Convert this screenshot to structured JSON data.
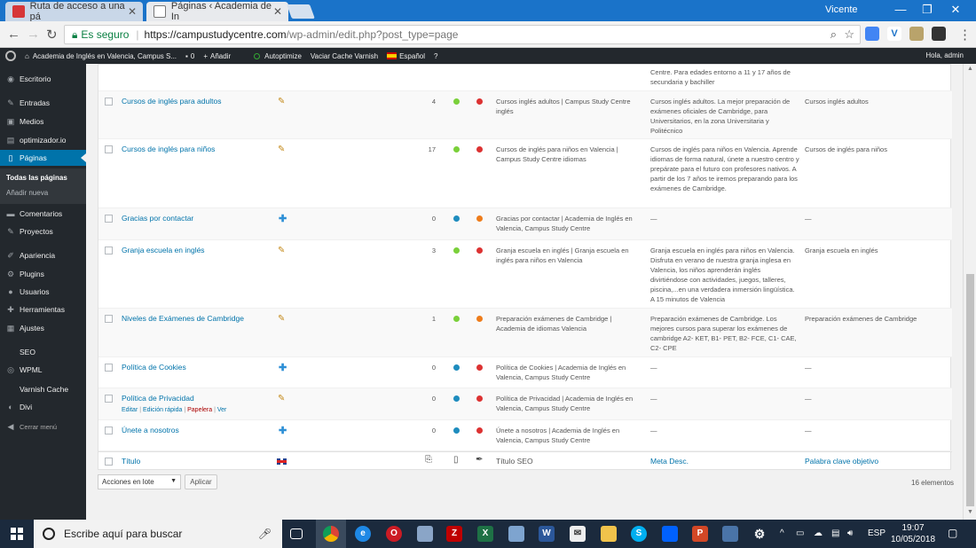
{
  "browser": {
    "tabs": [
      {
        "label": "Ruta de acceso a una pá"
      },
      {
        "label": "Páginas ‹ Academia de In"
      }
    ],
    "user": "Vicente",
    "omnibox": {
      "secure_label": "Es seguro",
      "url_host": "https://campustudycentre.com",
      "url_path": "/wp-admin/edit.php?post_type=page"
    }
  },
  "adminbar": {
    "site": "Academia de Inglés en Valencia, Campus S...",
    "comments": "0",
    "add_new": "Añadir",
    "autoptimize": "Autoptimize",
    "varnish": "Vaciar Cache Varnish",
    "language": "Español",
    "greeting": "Hola, admin"
  },
  "sidebar": {
    "items": [
      {
        "label": "Escritorio",
        "icon": "dashboard-icon"
      },
      {
        "label": "Entradas",
        "icon": "pin-icon"
      },
      {
        "label": "Medios",
        "icon": "media-icon"
      },
      {
        "label": "optimizador.io",
        "icon": "optimizer-icon"
      },
      {
        "label": "Páginas",
        "icon": "pages-icon"
      },
      {
        "label": "Comentarios",
        "icon": "comments-icon"
      },
      {
        "label": "Proyectos",
        "icon": "projects-icon"
      },
      {
        "label": "Apariencia",
        "icon": "appearance-icon"
      },
      {
        "label": "Plugins",
        "icon": "plugins-icon"
      },
      {
        "label": "Usuarios",
        "icon": "users-icon"
      },
      {
        "label": "Herramientas",
        "icon": "tools-icon"
      },
      {
        "label": "Ajustes",
        "icon": "settings-icon"
      },
      {
        "label": "SEO",
        "icon": ""
      },
      {
        "label": "WPML",
        "icon": "wpml-icon"
      },
      {
        "label": "Varnish Cache",
        "icon": ""
      },
      {
        "label": "Divi",
        "icon": "divi-icon"
      },
      {
        "label": "Cerrar menú",
        "icon": "collapse-icon"
      }
    ],
    "submenu": {
      "all_pages": "Todas las páginas",
      "add_new": "Añadir nueva"
    }
  },
  "table": {
    "top_partial": {
      "meta": "Centre. Para edades entorno a 11 y 17 años de secundaria y bachiller"
    },
    "rows": [
      {
        "title": "Cursos de inglés para adultos",
        "count": "4",
        "seo_title": "Cursos inglés adultos | Campus Study Centre inglés",
        "meta": "Cursos inglés adultos. La mejor preparación de exámenes oficiales de Cambridge, para Universitarios, en la zona Universitaria y Politécnico",
        "keyword": "Cursos inglés adultos"
      },
      {
        "title": "Cursos de inglés para niños",
        "count": "17",
        "seo_title": "Cursos de inglés para niños en Valencia | Campus Study Centre idiomas",
        "meta": "Cursos de inglés para niños en Valencia. Aprende idiomas de forma natural, únete a nuestro centro y prepárate para el futuro con profesores nativos. A partir de los 7 años te iremos preparando para los exámenes de Cambridge.",
        "keyword": "Cursos de inglés para niños"
      },
      {
        "title": "Gracias por contactar",
        "count": "0",
        "seo_title": "Gracias por contactar | Academia de Inglés en Valencia, Campus Study Centre",
        "meta": "—",
        "keyword": "—"
      },
      {
        "title": "Granja escuela en inglés",
        "count": "3",
        "seo_title": "Granja escuela en inglés | Granja escuela en inglés para niños en Valencia",
        "meta": "Granja escuela en inglés para niños en Valencia. Disfruta en verano de nuestra granja inglesa en Valencia, los niños aprenderán inglés divirtiéndose con actividades, juegos, talleres, piscina,...en una verdadera inmersión lingüística. A 15 minutos de Valencia",
        "keyword": "Granja escuela en inglés"
      },
      {
        "title": "Niveles de Exámenes de Cambridge",
        "count": "1",
        "seo_title": "Preparación exámenes de Cambridge | Academia de idiomas Valencia",
        "meta": "Preparación exámenes de Cambridge. Los mejores cursos para superar los exámenes de cambridge A2- KET, B1- PET, B2- FCE, C1- CAE, C2- CPE",
        "keyword": "Preparación exámenes de Cambridge"
      },
      {
        "title": "Política de Cookies",
        "count": "0",
        "seo_title": "Política de Cookies | Academia de Inglés en Valencia, Campus Study Centre",
        "meta": "—",
        "keyword": "—"
      },
      {
        "title": "Política de Privacidad",
        "count": "0",
        "seo_title": "Política de Privacidad | Academia de Inglés en Valencia, Campus Study Centre",
        "meta": "—",
        "keyword": "—",
        "actions": {
          "edit": "Editar",
          "quick": "Edición rápida",
          "trash": "Papelera",
          "view": "Ver"
        }
      },
      {
        "title": "Únete a nosotros",
        "count": "0",
        "seo_title": "Únete a nosotros | Academia de Inglés en Valencia, Campus Study Centre",
        "meta": "—",
        "keyword": "—"
      }
    ],
    "footer": {
      "title": "Título",
      "seo_title": "Título SEO",
      "meta": "Meta Desc.",
      "keyword": "Palabra clave objetivo"
    },
    "bulk_actions": "Acciones en lote",
    "apply": "Aplicar",
    "item_count": "16 elementos"
  },
  "taskbar": {
    "search_placeholder": "Escribe aquí para buscar",
    "lang": "ESP",
    "time": "19:07",
    "date": "10/05/2018"
  },
  "colors": {
    "wp_blue": "#0073aa",
    "admin_dark": "#23282d",
    "dot_green": "#7ad03a",
    "dot_red": "#dc3232",
    "dot_blue": "#1e8cbe",
    "dot_orange": "#ee7c1b"
  }
}
